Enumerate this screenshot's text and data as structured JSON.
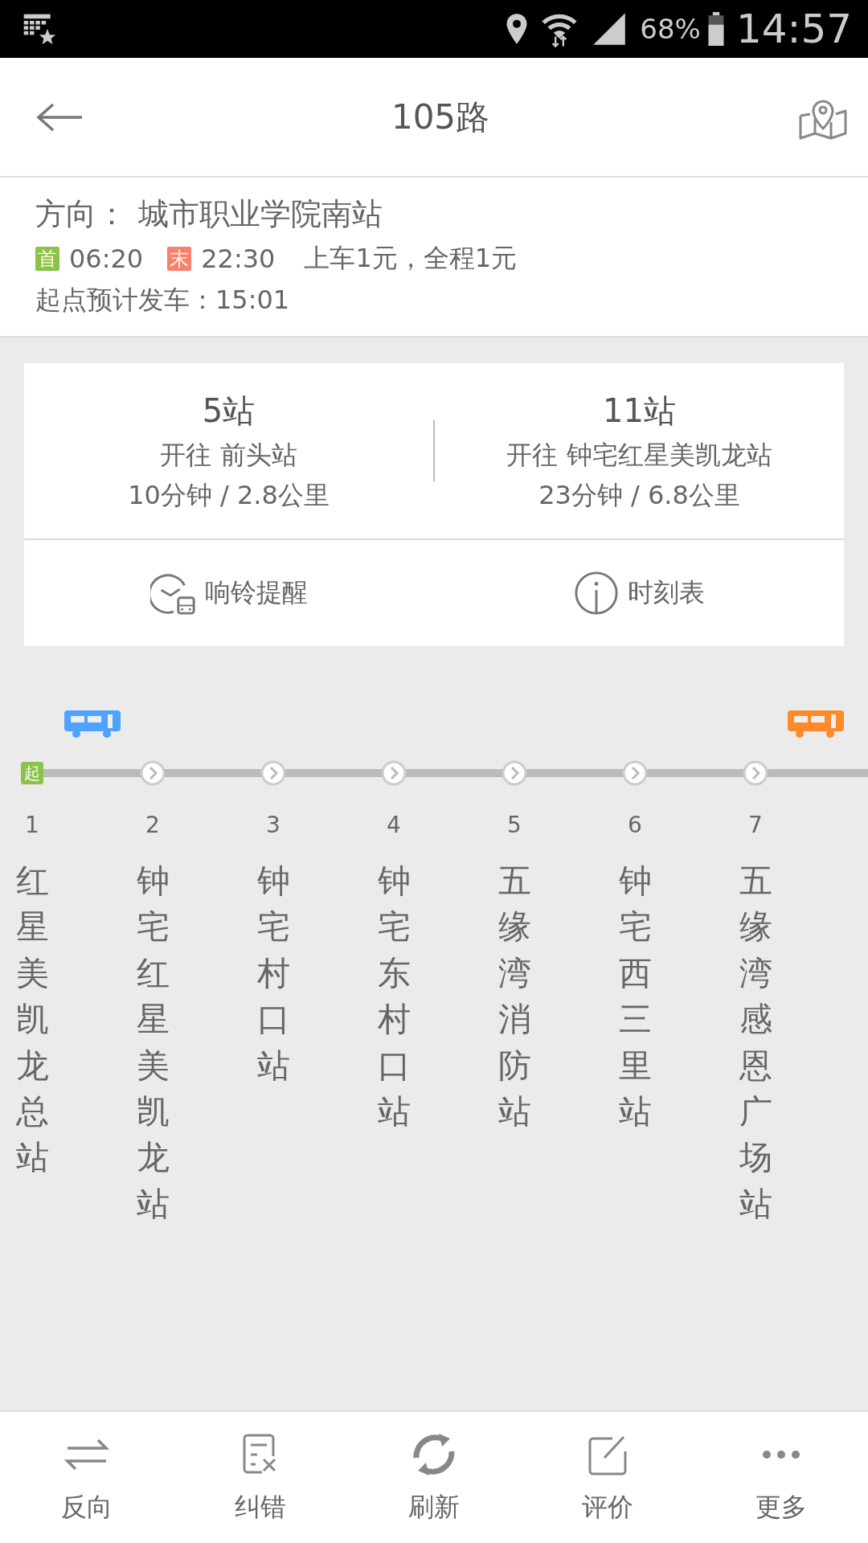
{
  "status_bar": {
    "battery": "68%",
    "time": "14:57"
  },
  "header": {
    "title": "105路"
  },
  "info": {
    "direction_label": "方向：",
    "direction": "城市职业学院南站",
    "times": [
      {
        "badge": "首",
        "color": "#8bc34a",
        "time": "06:20"
      },
      {
        "badge": "末",
        "color": "#f4826f",
        "time": "22:30"
      }
    ],
    "fare": "上车1元，全程1元",
    "departure": "起点预计发车：15:01"
  },
  "summary": [
    {
      "stops": "5站",
      "destination": "开往 前头站",
      "eta": "10分钟 / 2.8公里"
    },
    {
      "stops": "11站",
      "destination": "开往 钟宅红星美凯龙站",
      "eta": "23分钟 / 6.8公里"
    }
  ],
  "actions": [
    {
      "kind": "alarm",
      "label": "响铃提醒"
    },
    {
      "kind": "info",
      "label": "时刻表"
    }
  ],
  "stations": [
    {
      "number": "1",
      "name": "红星美凯龙总站",
      "badge": "起",
      "bus": {
        "color": "#4da3ff"
      }
    },
    {
      "number": "2",
      "name": "钟宅红星美凯龙站"
    },
    {
      "number": "3",
      "name": "钟宅村口站"
    },
    {
      "number": "4",
      "name": "钟宅东村口站"
    },
    {
      "number": "5",
      "name": "五缘湾消防站"
    },
    {
      "number": "6",
      "name": "钟宅西三里站"
    },
    {
      "number": "7",
      "name": "五缘湾感恩广场站",
      "bus": {
        "color": "#ff8a2a"
      }
    }
  ],
  "bottom_nav": [
    {
      "kind": "swap",
      "label": "反向"
    },
    {
      "kind": "report",
      "label": "纠错"
    },
    {
      "kind": "refresh",
      "label": "刷新"
    },
    {
      "kind": "edit",
      "label": "评价"
    },
    {
      "kind": "more",
      "label": "更多"
    }
  ]
}
